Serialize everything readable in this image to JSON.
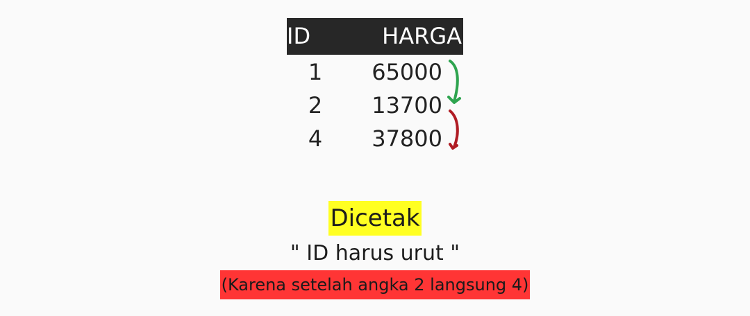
{
  "table": {
    "header": {
      "id": "ID",
      "harga": "HARGA"
    },
    "rows": [
      {
        "id": "1",
        "harga": "65000"
      },
      {
        "id": "2",
        "harga": "13700"
      },
      {
        "id": "4",
        "harga": "37800"
      }
    ]
  },
  "annotations": {
    "arrow_1_to_2": {
      "color": "#2ea44f",
      "meaning": "ok"
    },
    "arrow_2_to_4": {
      "color": "#b01c24",
      "meaning": "skip"
    }
  },
  "output": {
    "title": "Dicetak",
    "message": "\" ID harus urut \"",
    "reason": "(Karena setelah angka 2 langsung 4)"
  },
  "colors": {
    "header_bg": "#272727",
    "title_highlight": "#ffff22",
    "reason_highlight": "#ff3535"
  }
}
